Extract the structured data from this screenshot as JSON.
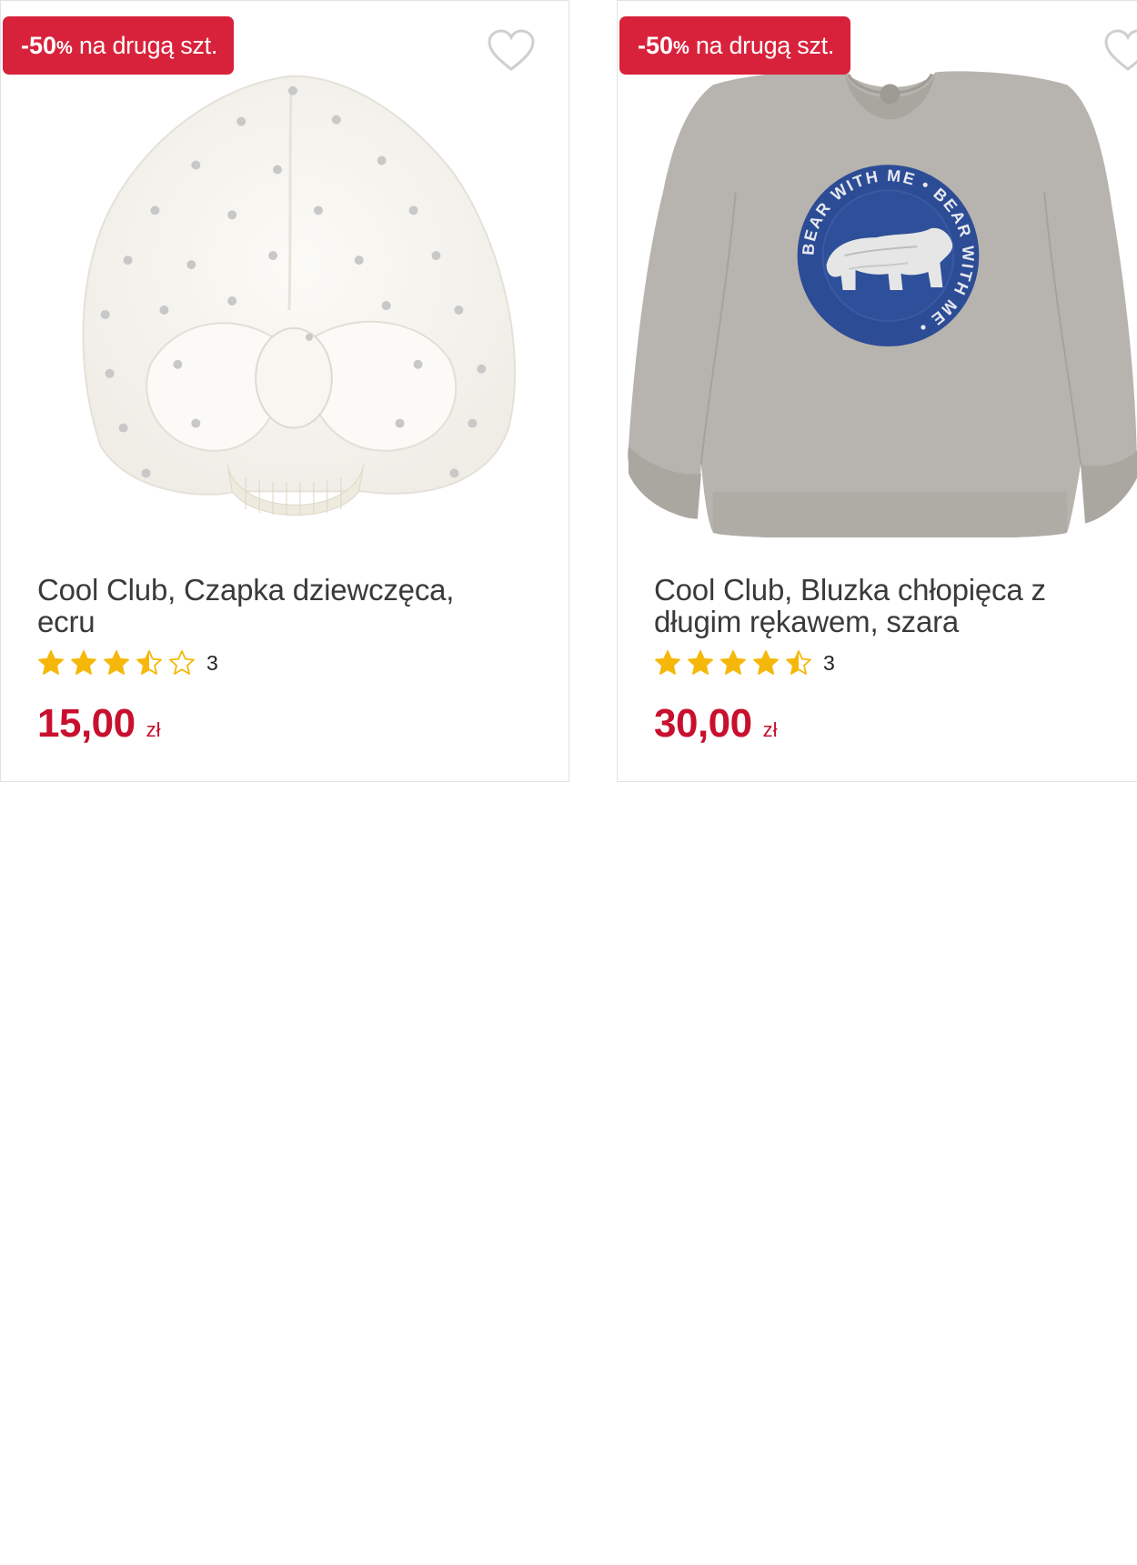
{
  "colors": {
    "badge_bg": "#d8223b",
    "price": "#c8102e",
    "star": "#f5b80a",
    "title": "#3a3a3a"
  },
  "products": [
    {
      "badge_pct": "-50",
      "badge_pct_sign": "%",
      "badge_text": "na drugą szt.",
      "title": "Cool Club, Czapka dziewczęca, ecru",
      "rating": 3.5,
      "rating_count": "3",
      "price": "15,00",
      "currency": "zł",
      "favorite_icon": "heart-outline-icon",
      "image": "white turban hat with silver hearts and bow"
    },
    {
      "badge_pct": "-50",
      "badge_pct_sign": "%",
      "badge_text": "na drugą szt.",
      "title": "Cool Club, Bluzka chłopięca z długim rękawem, szara",
      "rating": 4.5,
      "rating_count": "3",
      "price": "30,00",
      "currency": "zł",
      "favorite_icon": "heart-outline-icon",
      "image": "grey sweatshirt with blue bear print",
      "print_text": "BEAR WITH ME • BEAR WITH ME •"
    }
  ]
}
